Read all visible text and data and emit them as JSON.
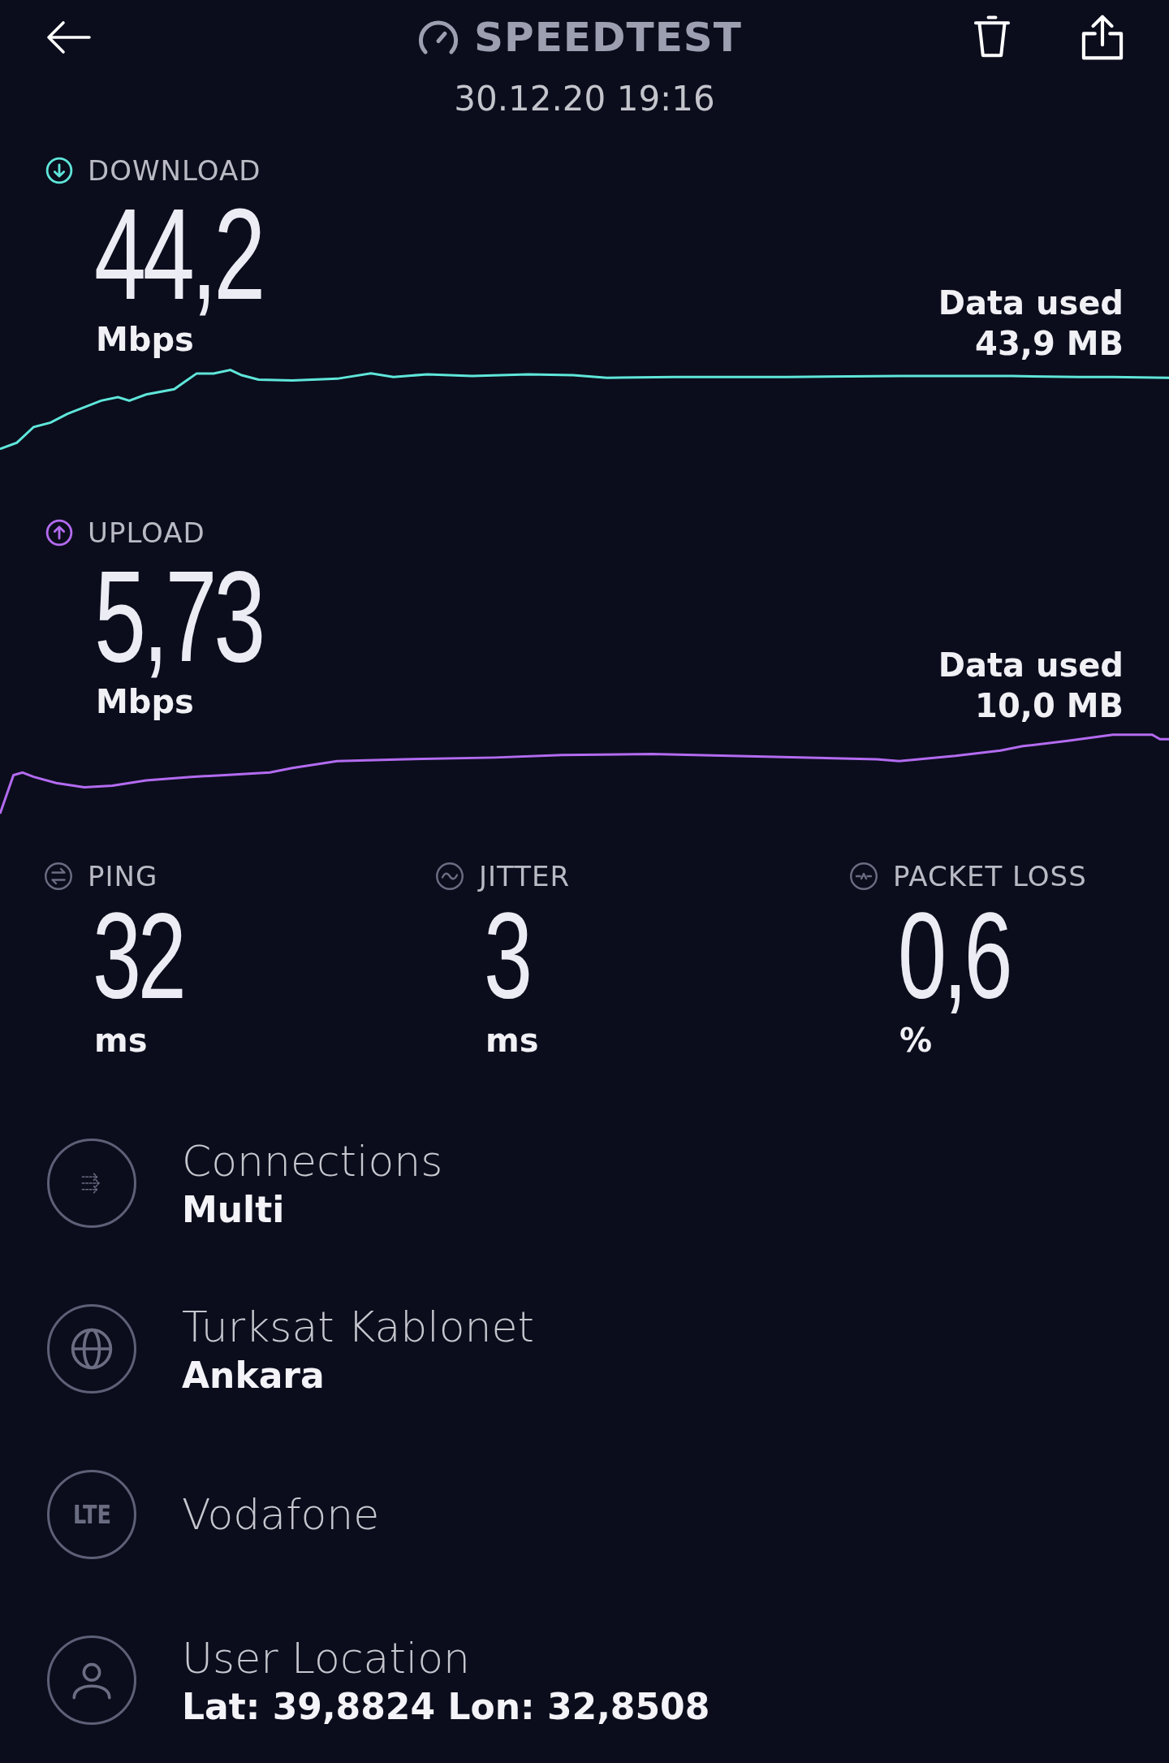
{
  "header": {
    "title": "SPEEDTEST",
    "timestamp": "30.12.20 19:16"
  },
  "results": [
    {
      "kind": "download",
      "label": "DOWNLOAD",
      "value": "44,2",
      "unit": "Mbps",
      "data_used_label": "Data used",
      "data_used": "43,9 MB",
      "color": "#5fe6da"
    },
    {
      "kind": "upload",
      "label": "UPLOAD",
      "value": "5,73",
      "unit": "Mbps",
      "data_used_label": "Data used",
      "data_used": "10,0 MB",
      "color": "#b36bf0"
    }
  ],
  "stats": [
    {
      "kind": "ping",
      "label": "PING",
      "value": "32",
      "unit": "ms"
    },
    {
      "kind": "jitter",
      "label": "JITTER",
      "value": "3",
      "unit": "ms"
    },
    {
      "kind": "packet_loss",
      "label": "PACKET LOSS",
      "value": "0,6",
      "unit": "%"
    }
  ],
  "details": [
    {
      "kind": "connections",
      "title": "Connections",
      "subtitle": "Multi"
    },
    {
      "kind": "server",
      "title": "Turksat Kablonet",
      "subtitle": "Ankara"
    },
    {
      "kind": "network",
      "badge": "LTE",
      "title": "Vodafone"
    },
    {
      "kind": "location",
      "title": "User Location",
      "subtitle": "Lat: 39,8824 Lon: 32,8508"
    }
  ]
}
